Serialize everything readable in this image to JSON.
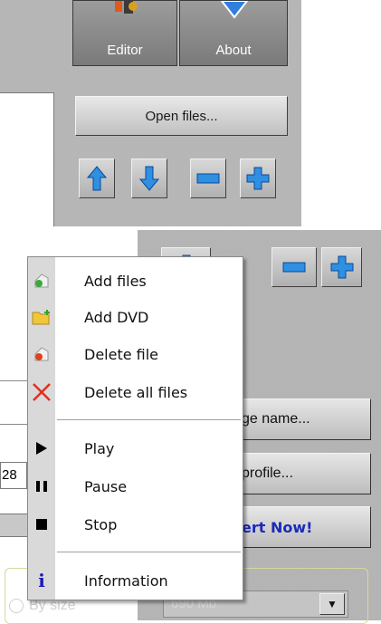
{
  "toolbar": {
    "editor_label": "Editor",
    "about_label": "About"
  },
  "actions": {
    "open_files_label": "Open files...",
    "change_name_label": "ge name...",
    "profile_label": "profile...",
    "convert_label": "ert Now!"
  },
  "left_field_value": "28",
  "context_menu": {
    "items": [
      {
        "label": "Add files",
        "icon": "add-file-icon"
      },
      {
        "label": "Add DVD",
        "icon": "add-dvd-icon"
      },
      {
        "label": "Delete file",
        "icon": "delete-file-icon"
      },
      {
        "label": "Delete all files",
        "icon": "delete-all-icon"
      },
      {
        "label": "Play",
        "icon": "play-icon"
      },
      {
        "label": "Pause",
        "icon": "pause-icon"
      },
      {
        "label": "Stop",
        "icon": "stop-icon"
      },
      {
        "label": "Information",
        "icon": "info-icon"
      }
    ]
  },
  "bottom": {
    "by_size_label": "By size",
    "size_value": "690 Mb"
  },
  "colors": {
    "arrow_blue": "#2f8fe0",
    "convert_text": "#1a2ab8",
    "delete_red": "#e03020",
    "info_blue": "#1a1ab8"
  }
}
